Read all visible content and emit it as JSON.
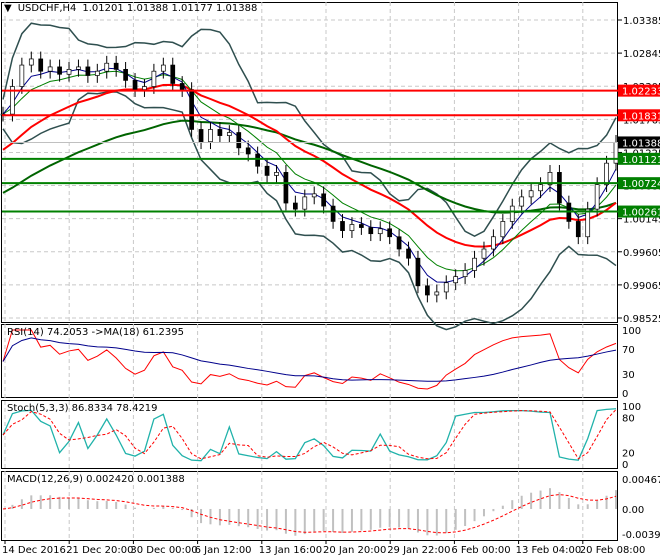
{
  "header": {
    "symbol": "USDCHF,H4",
    "ohlc": "1.01201 1.01388 1.01177 1.01388"
  },
  "indicators": {
    "rsi": "RSI(14) 74.2053  ->MA(18) 61.2395",
    "stoch": "Stoch(5,3,3) 86.8334 78.4219",
    "macd": "MACD(12,26,9) 0.002420 0.001388"
  },
  "chart_data": {
    "type": "candlestick",
    "ylim": [
      0.98525,
      1.03385
    ],
    "price_ticks": [
      "1.03385",
      "1.02845",
      "1.02305",
      "1.01765",
      "1.01225",
      "1.00685",
      "1.00145",
      "0.99605",
      "0.99065",
      "0.98525"
    ],
    "time_ticks": [
      "14 Dec 2016",
      "21 Dec 20:00",
      "30 Dec 00:00",
      "6 Jan 12:00",
      "13 Jan 16:00",
      "20 Jan 20:00",
      "29 Jan 22:00",
      "6 Feb 00:00",
      "13 Feb 04:00",
      "20 Feb 08:00"
    ],
    "current_price": {
      "value": 1.01388,
      "label": "1.01388"
    },
    "levels": [
      {
        "value": 1.02233,
        "label": "1.02233",
        "color": "#ff0000"
      },
      {
        "value": 1.01831,
        "label": "1.01831",
        "color": "#ff0000"
      },
      {
        "value": 1.01121,
        "label": "1.01121",
        "color": "#008000"
      },
      {
        "value": 1.00724,
        "label": "1.00724",
        "color": "#008000"
      },
      {
        "value": 1.00261,
        "label": "1.00261",
        "color": "#008000"
      }
    ],
    "closes": [
      1.0185,
      1.023,
      1.0265,
      1.0275,
      1.0255,
      1.0262,
      1.025,
      1.0258,
      1.0262,
      1.0248,
      1.0255,
      1.0268,
      1.0258,
      1.024,
      1.0225,
      1.023,
      1.0255,
      1.0265,
      1.0235,
      1.0225,
      1.016,
      1.014,
      1.016,
      1.015,
      1.0155,
      1.013,
      1.012,
      1.01,
      1.0085,
      1.009,
      1.004,
      1.003,
      1.005,
      1.0055,
      1.0035,
      1.001,
      0.9995,
      1.0005,
      1.0,
      0.999,
      0.9998,
      0.9985,
      0.9965,
      0.995,
      0.9905,
      0.989,
      0.9895,
      0.991,
      0.992,
      0.993,
      0.995,
      0.9965,
      0.9985,
      1.001,
      1.0035,
      1.005,
      1.006,
      1.007,
      1.009,
      1.004,
      1.001,
      0.9985,
      1.003,
      1.007,
      1.0105,
      1.0139
    ],
    "rsi_axis": [
      "100",
      "70",
      "30",
      "0"
    ],
    "stoch_axis": [
      "100",
      "80",
      "20",
      "0"
    ],
    "macd_axis": [
      "0.004671",
      "0.00",
      "-0.0039"
    ],
    "colors": {
      "ma_fast": "#00008b",
      "ma_mid": "#008000",
      "ma_slow": "#ff0000",
      "ma_long": "#006400",
      "bands": "#2f4f4f",
      "rsi": "#ff0000",
      "rsi_ma": "#00008b",
      "stoch_main": "#20b2aa",
      "stoch_signal": "#ff0000",
      "macd_hist": "#c0c0c0",
      "macd_signal": "#ff0000"
    }
  }
}
